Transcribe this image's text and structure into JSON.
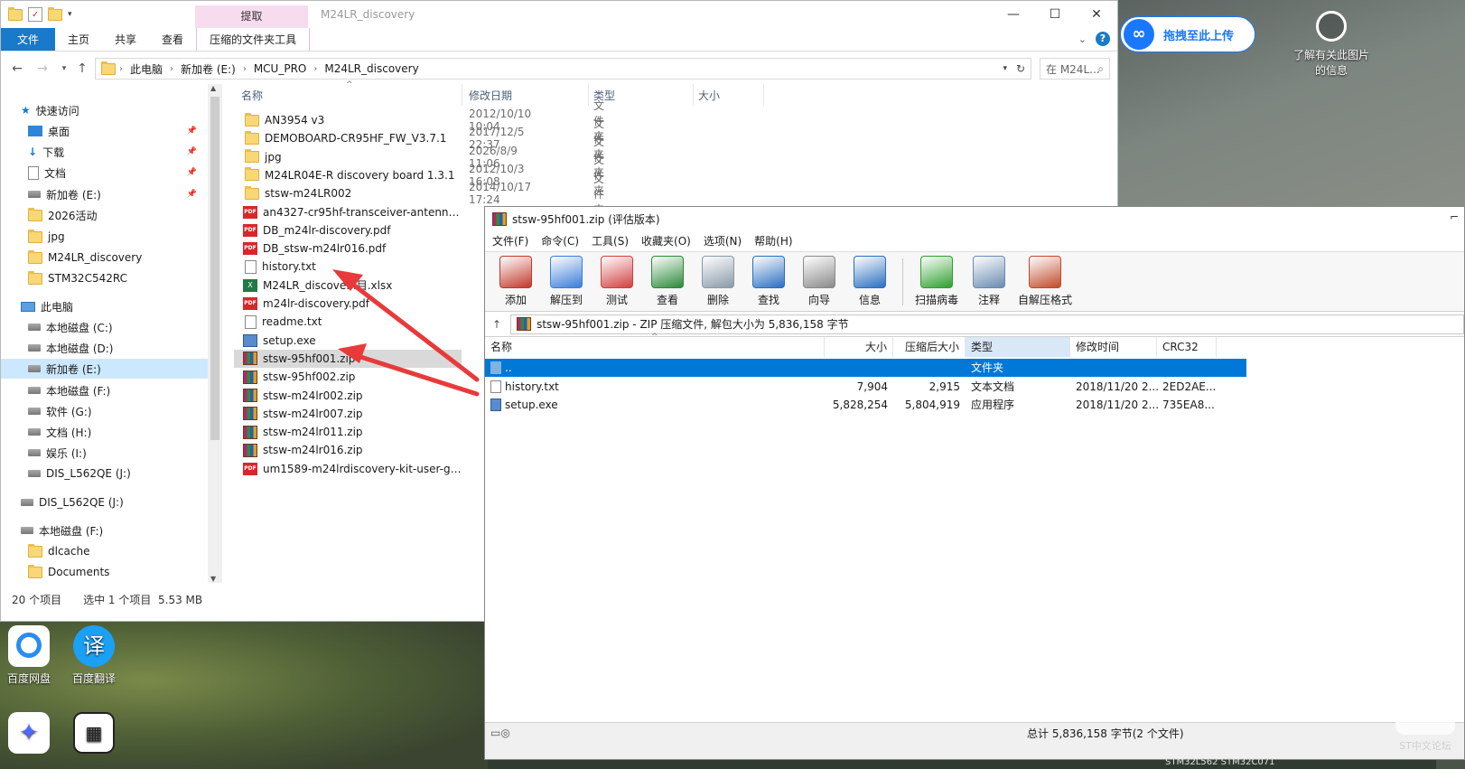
{
  "explorer": {
    "ribbon_context_tab": "提取",
    "title": "M24LR_discovery",
    "tabs": [
      "文件",
      "主页",
      "共享",
      "查看",
      "压缩的文件夹工具"
    ],
    "breadcrumbs": [
      "此电脑",
      "新加卷 (E:)",
      "MCU_PRO",
      "M24LR_discovery"
    ],
    "search_placeholder": "在 M24L...",
    "nav": [
      {
        "label": "快速访问",
        "icon": "star-icon"
      },
      {
        "label": "桌面",
        "icon": "desktop-icon",
        "pinned": true
      },
      {
        "label": "下载",
        "icon": "download-icon",
        "pinned": true
      },
      {
        "label": "文档",
        "icon": "documents-icon",
        "pinned": true
      },
      {
        "label": "新加卷 (E:)",
        "icon": "drive-icon",
        "pinned": true
      },
      {
        "label": "2026活动",
        "icon": "folder-icon"
      },
      {
        "label": "jpg",
        "icon": "folder-icon"
      },
      {
        "label": "M24LR_discovery",
        "icon": "folder-icon"
      },
      {
        "label": "STM32C542RC",
        "icon": "folder-icon"
      },
      {
        "label": "此电脑",
        "icon": "pc-icon"
      },
      {
        "label": "本地磁盘 (C:)",
        "icon": "drive-icon"
      },
      {
        "label": "本地磁盘 (D:)",
        "icon": "drive-icon"
      },
      {
        "label": "新加卷 (E:)",
        "icon": "drive-icon",
        "selected": true
      },
      {
        "label": "本地磁盘 (F:)",
        "icon": "drive-icon"
      },
      {
        "label": "软件 (G:)",
        "icon": "drive-icon"
      },
      {
        "label": "文档 (H:)",
        "icon": "drive-icon"
      },
      {
        "label": "娱乐 (I:)",
        "icon": "drive-icon"
      },
      {
        "label": "DIS_L562QE (J:)",
        "icon": "drive-icon"
      },
      {
        "label": "DIS_L562QE (J:)",
        "icon": "drive-icon"
      },
      {
        "label": "本地磁盘 (F:)",
        "icon": "drive-icon"
      },
      {
        "label": "dlcache",
        "icon": "folder-icon"
      },
      {
        "label": "Documents",
        "icon": "folder-icon"
      }
    ],
    "columns": [
      "名称",
      "修改日期",
      "类型",
      "大小"
    ],
    "files": [
      {
        "name": "AN3954 v3",
        "kind": "folder",
        "date": "2012/10/10 10:04",
        "type": "文件夹"
      },
      {
        "name": "DEMOBOARD-CR95HF_FW_V3.7.1",
        "kind": "folder",
        "date": "2017/12/5 22:37",
        "type": "文件夹"
      },
      {
        "name": "jpg",
        "kind": "folder",
        "date": "2026/8/9 11:06",
        "type": "文件夹"
      },
      {
        "name": "M24LR04E-R discovery board 1.3.1",
        "kind": "folder",
        "date": "2012/10/3 16:08",
        "type": "文件夹"
      },
      {
        "name": "stsw-m24LR002",
        "kind": "folder",
        "date": "2014/10/17 17:24",
        "type": "文件夹"
      },
      {
        "name": "an4327-cr95hf-transceiver-antenna-t...",
        "kind": "pdf"
      },
      {
        "name": "DB_m24lr-discovery.pdf",
        "kind": "pdf"
      },
      {
        "name": "DB_stsw-m24lr016.pdf",
        "kind": "pdf"
      },
      {
        "name": "history.txt",
        "kind": "txt"
      },
      {
        "name": "M24LR_discove...目.xlsx",
        "kind": "xlsx"
      },
      {
        "name": "m24lr-discovery.pdf",
        "kind": "pdf"
      },
      {
        "name": "readme.txt",
        "kind": "txt"
      },
      {
        "name": "setup.exe",
        "kind": "exe"
      },
      {
        "name": "stsw-95hf001.zip",
        "kind": "zip",
        "selected": true
      },
      {
        "name": "stsw-95hf002.zip",
        "kind": "zip"
      },
      {
        "name": "stsw-m24lr002.zip",
        "kind": "zip"
      },
      {
        "name": "stsw-m24lr007.zip",
        "kind": "zip"
      },
      {
        "name": "stsw-m24lr011.zip",
        "kind": "zip"
      },
      {
        "name": "stsw-m24lr016.zip",
        "kind": "zip"
      },
      {
        "name": "um1589-m24lrdiscovery-kit-user-gui...",
        "kind": "pdf"
      }
    ],
    "status_count": "20 个项目",
    "status_selection": "选中 1 个项目",
    "status_size": "5.53 MB"
  },
  "desktop": {
    "icons": [
      {
        "label": "百度网盘",
        "icon": "baidu-netdisk-icon",
        "color": "#2a8cf0"
      },
      {
        "label": "百度翻译",
        "icon": "baidu-translate-icon",
        "color": "#1aa0f5"
      },
      {
        "label": "",
        "icon": "deepseek-icon",
        "color": "#4d6bfe"
      },
      {
        "label": "",
        "icon": "logic-analyzer-icon",
        "color": "#222222"
      }
    ],
    "upload_pill": "拖拽至此上传",
    "info_card": "了解有关此图片的信息",
    "forum_label": "ST中文论坛"
  },
  "rar": {
    "title": "stsw-95hf001.zip (评估版本)",
    "menu": [
      "文件(F)",
      "命令(C)",
      "工具(S)",
      "收藏夹(O)",
      "选项(N)",
      "帮助(H)"
    ],
    "toolbar": [
      {
        "label": "添加",
        "icon": "add-archive-icon",
        "color": "#c0392b"
      },
      {
        "label": "解压到",
        "icon": "extract-to-icon",
        "color": "#3b7dd8"
      },
      {
        "label": "测试",
        "icon": "test-icon",
        "color": "#d04040"
      },
      {
        "label": "查看",
        "icon": "view-icon",
        "color": "#2c8a3a"
      },
      {
        "label": "删除",
        "icon": "delete-icon",
        "color": "#8a9aa8"
      },
      {
        "label": "查找",
        "icon": "find-icon",
        "color": "#2a6fc0"
      },
      {
        "label": "向导",
        "icon": "wizard-icon",
        "color": "#8a8a8a"
      },
      {
        "label": "信息",
        "icon": "info-icon",
        "color": "#2a6fc0"
      },
      {
        "label": "扫描病毒",
        "icon": "scan-virus-icon",
        "color": "#2ea02e"
      },
      {
        "label": "注释",
        "icon": "comment-icon",
        "color": "#6a8bb0"
      },
      {
        "label": "自解压格式",
        "icon": "sfx-icon",
        "color": "#c04a2a"
      }
    ],
    "path": "stsw-95hf001.zip - ZIP 压缩文件, 解包大小为 5,836,158 字节",
    "columns": [
      "名称",
      "大小",
      "压缩后大小",
      "类型",
      "修改时间",
      "CRC32"
    ],
    "rows": [
      {
        "name": "..",
        "size": "",
        "packed": "",
        "type": "文件夹",
        "mtime": "",
        "crc": "",
        "selected": true
      },
      {
        "name": "history.txt",
        "size": "7,904",
        "packed": "2,915",
        "type": "文本文档",
        "mtime": "2018/11/20 2...",
        "crc": "2ED2AE..."
      },
      {
        "name": "setup.exe",
        "size": "5,828,254",
        "packed": "5,804,919",
        "type": "应用程序",
        "mtime": "2018/11/20 2...",
        "crc": "735EA8..."
      }
    ],
    "status": "总计 5,836,158 字节(2 个文件)"
  },
  "bottom_strip": "STM32L562 STM32C071"
}
